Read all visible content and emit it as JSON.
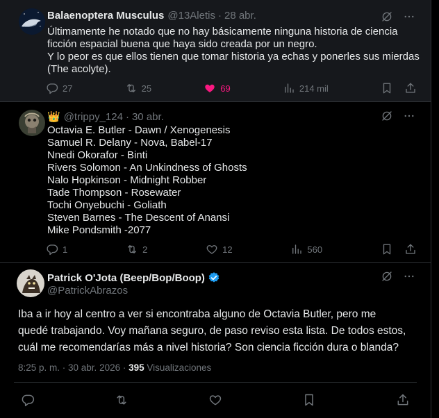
{
  "reply1": {
    "name": "Balaenoptera Musculus",
    "handle": "@13Aletis",
    "sep": "·",
    "date": "28 abr.",
    "text": "Últimamente he notado que no hay básicamente ninguna historia de ciencia\nficción espacial buena que haya sido creada por un negro.\nY lo peor es que ellos tienen que tomar historia ya echas y ponerles sus mierdas\n(The acolyte).",
    "replies": "27",
    "reposts": "25",
    "likes": "69",
    "views": "214 mil"
  },
  "reply2": {
    "crown": "👑",
    "handle": "@trippy_124",
    "sep": "·",
    "date": "30 abr.",
    "text": "Octavia E. Butler - Dawn / Xenogenesis\nSamuel R. Delany - Nova, Babel-17\nNnedi Okorafor - Binti\nRivers Solomon - An Unkindness of Ghosts\nNalo Hopkinson - Midnight Robber\nTade Thompson - Rosewater\nTochi Onyebuchi - Goliath\nSteven Barnes - The Descent of Anansi\nMike Pondsmith -2077",
    "replies": "1",
    "reposts": "2",
    "likes": "12",
    "views": "560"
  },
  "main": {
    "name": "Patrick O'Jota (Beep/Bop/Boop)",
    "handle": "@PatrickAbrazos",
    "text": "Iba a ir hoy al centro a ver si encontraba alguno de Octavia Butler, pero me quedé trabajando. Voy mañana seguro, de paso reviso esta lista. De todos estos, cuál me recomendarías más a nivel historia? Son ciencia ficción dura o blanda?",
    "time": "8:25 p. m. · 30 abr. 2026 ·",
    "views_count": "395",
    "views_label": "Visualizaciones"
  },
  "colors": {
    "like_active": "#f91880",
    "verified": "#1d9bf0",
    "muted": "#71767b",
    "text": "#e7e9ea"
  },
  "icons": [
    "reply-icon",
    "repost-icon",
    "like-icon",
    "views-icon",
    "bookmark-icon",
    "share-icon",
    "grok-icon",
    "more-icon",
    "verified-icon"
  ]
}
